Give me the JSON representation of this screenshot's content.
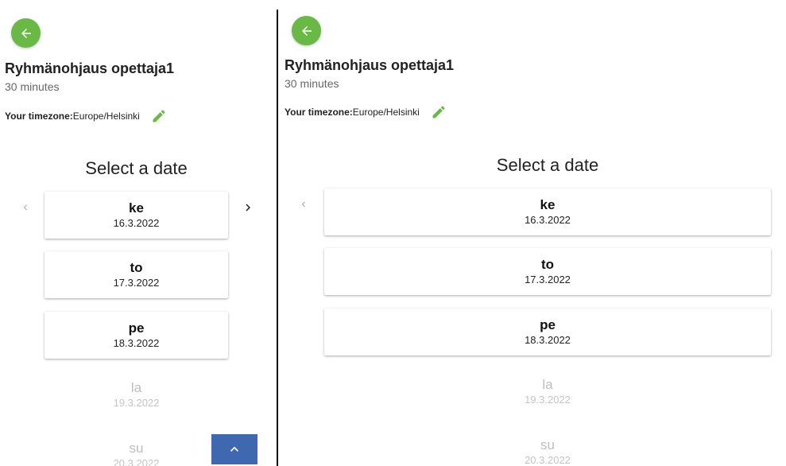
{
  "panels": [
    {
      "title": "Ryhmänohjaus opettaja1",
      "duration": "30 minutes",
      "timezone_label": "Your timezone:",
      "timezone_value": "Europe/Helsinki",
      "heading": "Select a date",
      "dates": [
        {
          "day": "ke",
          "date": "16.3.2022",
          "available": true
        },
        {
          "day": "to",
          "date": "17.3.2022",
          "available": true
        },
        {
          "day": "pe",
          "date": "18.3.2022",
          "available": true
        },
        {
          "day": "la",
          "date": "19.3.2022",
          "available": false
        },
        {
          "day": "su",
          "date": "20.3.2022",
          "available": false
        }
      ]
    },
    {
      "title": "Ryhmänohjaus opettaja1",
      "duration": "30 minutes",
      "timezone_label": "Your timezone:",
      "timezone_value": "Europe/Helsinki",
      "heading": "Select a date",
      "dates": [
        {
          "day": "ke",
          "date": "16.3.2022",
          "available": true
        },
        {
          "day": "to",
          "date": "17.3.2022",
          "available": true
        },
        {
          "day": "pe",
          "date": "18.3.2022",
          "available": true
        },
        {
          "day": "la",
          "date": "19.3.2022",
          "available": false
        },
        {
          "day": "su",
          "date": "20.3.2022",
          "available": false
        }
      ]
    }
  ],
  "icons": {
    "back": "arrow-left-icon",
    "edit": "pencil-icon",
    "prev": "chevron-left-icon",
    "next": "chevron-right-icon",
    "scroll_top": "chevron-up-icon"
  },
  "colors": {
    "accent_green": "#6ab946",
    "scroll_button_blue": "#3f68b0",
    "disabled_text": "#bdbdbd"
  }
}
